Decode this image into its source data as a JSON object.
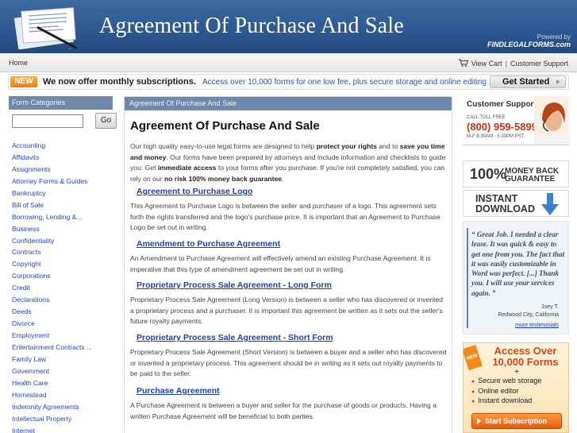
{
  "header": {
    "title": "Agreement Of Purchase And Sale",
    "powered_by": "Powered by",
    "provider": "FINDLEGALFORMS.com"
  },
  "topnav": {
    "home": "Home",
    "view_cart": "View Cart",
    "separator": "|",
    "customer_support": "Customer Support"
  },
  "promo": {
    "badge": "NEW",
    "message": "We now offer monthly subscriptions.",
    "sub": "Access over 10,000 forms for one low fee, plus secure storage and online editing",
    "button": "Get Started"
  },
  "sidebar": {
    "heading": "Form Categories",
    "search_value": "",
    "go": "Go",
    "categories": [
      "Accounting",
      "Affidavits",
      "Assignments",
      "Attorney Forms & Guides",
      "Bankruptcy",
      "Bill of Sale",
      "Borrowing, Lending &...",
      "Business",
      "Confidentiality",
      "Contracts",
      "Copyright",
      "Corporations",
      "Credit",
      "Declarations",
      "Deeds",
      "Divorce",
      "Employment",
      "Entertainment Contracts ...",
      "Family Law",
      "Government",
      "Health Care",
      "Homestead",
      "Indemnity Agreements",
      "Intellectual Property",
      "Internet"
    ]
  },
  "main": {
    "breadcrumb": "Agreement Of Purchase And Sale",
    "title": "Agreement Of Purchase And Sale",
    "intro": {
      "t1": "Our high quality easy-to-use legal forms are designed to help ",
      "b1": "protect your rights",
      "t2": " and to ",
      "b2": "save you time and money",
      "t3": ". Our forms have been prepared by attorneys and include information and checklists to guide you. Get ",
      "b3": "immediate access",
      "t4": " to your forms after you purchase. If you're not completely satisfied, you can rely on our ",
      "b4": "no risk 100% money back guarantee",
      "t5": "."
    },
    "entries": [
      {
        "title": "Agreement to Purchase Logo",
        "desc": "This Agreement to Purchase Logo is between the seller and purchaser of a logo. This agreement sets forth the rights transferred and the logo's purchase price. It is important that an Agreement to Purchase Logo be set out in writing."
      },
      {
        "title": "Amendment to Purchase Agreement",
        "desc": "An Amendment to Purchase Agreement will effectively amend an existing Purchase Agreement. It is imperative that this type of amendment agreement be set out in writing."
      },
      {
        "title": "Proprietary Process Sale Agreement - Long Form",
        "desc": "Proprietary Process Sale Agreement (Long Version) is between a seller who has discovered or invented a proprietary process and a purchaser. It is important this agreement be written as it sets out the seller's future royalty payments."
      },
      {
        "title": "Proprietary Process Sale Agreement - Short Form",
        "desc": "Proprietary Process Sale Agreement (Short Version) is between a buyer and a seller who has discovered or invented a proprietary process. This agreement should be in writing as it sets out royalty payments to be paid to the seller."
      },
      {
        "title": "Purchase Agreement",
        "desc": "A Purchase Agreement is between a buyer and seller for the purchase of goods or products. Having a written Purchase Agreement will be beneficial to both parties."
      }
    ]
  },
  "right": {
    "support_title": "Customer Support",
    "toll_free": "CALL TOLL FREE",
    "phone": "(800) 959-5899",
    "hours": "M-F 8:30AM - 5:30PM PST",
    "guarantee_pct": "100%",
    "guarantee_line1": "MONEY BACK",
    "guarantee_line2": "GUARANTEE",
    "instant_line1": "INSTANT",
    "instant_line2": "DOWNLOAD",
    "quote": "“ Great Job. I needed a clear lease. It was quick & easy to get one from you. The fact that it was easily customizable in Word was perfect. [...] Thank you. I will use your services again. ”",
    "author": "Joey T.",
    "location": "Redwood City, California",
    "more_testimonials": "more testimonials",
    "access_new": "NEW",
    "access_title": "Access Over 10,000 Forms",
    "access_plus": "+",
    "access_features": [
      "Secure web storage",
      "Online editor",
      "Instant download"
    ],
    "access_button": "Start Subscription"
  }
}
